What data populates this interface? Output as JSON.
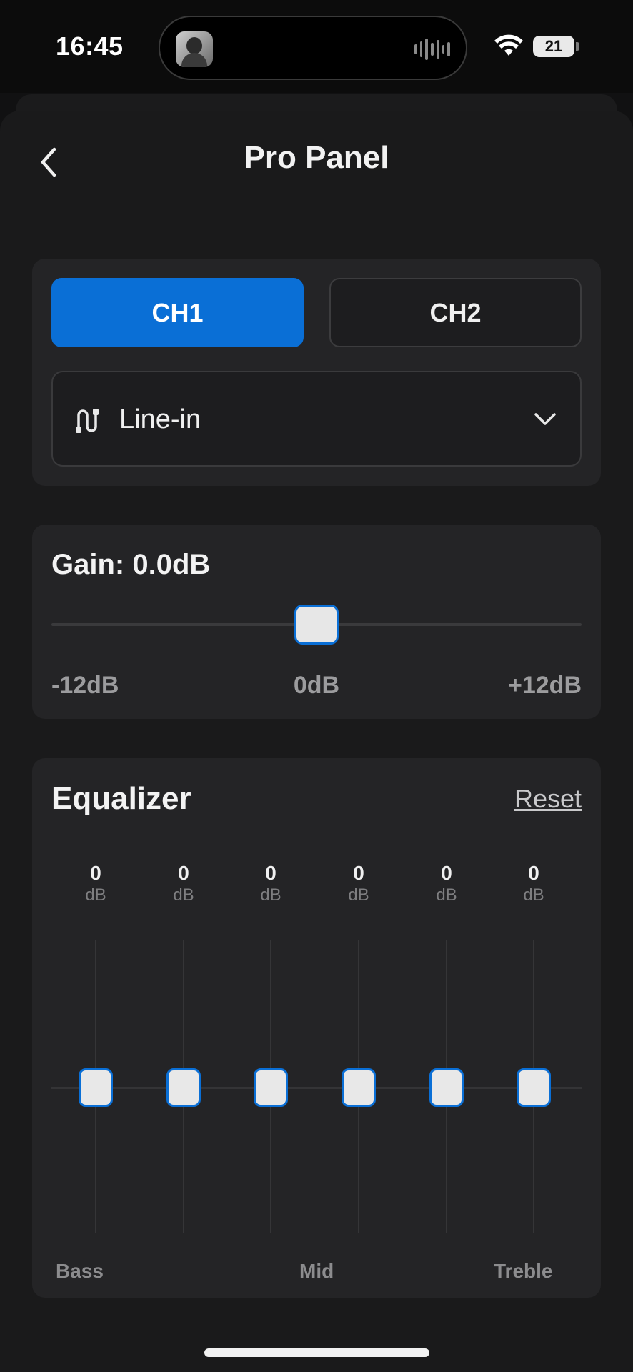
{
  "status_bar": {
    "time": "16:45",
    "battery": "21"
  },
  "header": {
    "title": "Pro Panel"
  },
  "channels": {
    "ch1_label": "CH1",
    "ch2_label": "CH2",
    "selected": "CH1"
  },
  "source": {
    "label": "Line-in",
    "icon": "line-in-cable-icon"
  },
  "gain": {
    "title": "Gain: 0.0dB",
    "min_label": "-12dB",
    "mid_label": "0dB",
    "max_label": "+12dB",
    "value_db": 0,
    "range_db": [
      -12,
      12
    ]
  },
  "equalizer": {
    "title": "Equalizer",
    "reset_label": "Reset",
    "unit": "dB",
    "bands": [
      {
        "value": "0",
        "unit": "dB"
      },
      {
        "value": "0",
        "unit": "dB"
      },
      {
        "value": "0",
        "unit": "dB"
      },
      {
        "value": "0",
        "unit": "dB"
      },
      {
        "value": "0",
        "unit": "dB"
      },
      {
        "value": "0",
        "unit": "dB"
      }
    ],
    "band_labels": {
      "low": "Bass",
      "mid": "Mid",
      "high": "Treble"
    }
  },
  "colors": {
    "accent": "#0a6fd6",
    "background": "#1a1a1b",
    "card": "#242426"
  }
}
